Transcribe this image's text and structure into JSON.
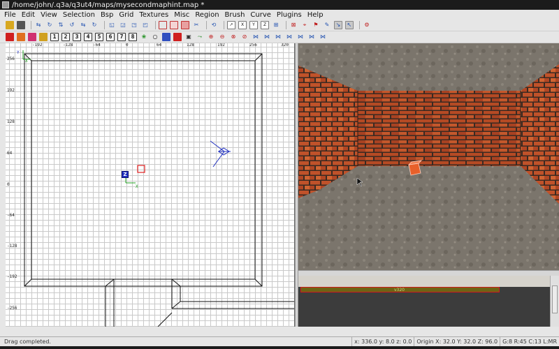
{
  "window": {
    "title": "/home/john/.q3a/q3ut4/maps/mysecondmaphint.map *"
  },
  "menu": [
    {
      "label": "File"
    },
    {
      "label": "Edit"
    },
    {
      "label": "View"
    },
    {
      "label": "Selection"
    },
    {
      "label": "Bsp"
    },
    {
      "label": "Grid"
    },
    {
      "label": "Textures"
    },
    {
      "label": "Misc"
    },
    {
      "label": "Region"
    },
    {
      "label": "Brush"
    },
    {
      "label": "Curve"
    },
    {
      "label": "Plugins"
    },
    {
      "label": "Help"
    }
  ],
  "toolbar2": {
    "numbers": [
      "1",
      "2",
      "3",
      "4",
      "5",
      "6",
      "7",
      "8"
    ]
  },
  "grid_view": {
    "x_ticks": [
      "-192",
      "-128",
      "-64",
      "0",
      "64",
      "128",
      "192",
      "256",
      "320"
    ],
    "y_ticks": [
      "256",
      "192",
      "128",
      "64",
      "0",
      "-64",
      "-128",
      "-192",
      "-256"
    ],
    "axis_y_label": "Y",
    "axis_x_label": "X",
    "origin_axis_label": "X",
    "z_label": "Z"
  },
  "texture_browser": {
    "tile_label": "v320"
  },
  "status": {
    "message": "Drag completed.",
    "coords": "x: 336.0  y: 8.0  z: 0.0",
    "origin": "Origin X: 32.0  Y: 32.0  Z: 96.0",
    "grid": "G:8 R:45 C:13 L:MR"
  },
  "colors": {
    "accent_selection": "#e02020",
    "camera_icon": "#2030c0",
    "brick": "#b04a26",
    "floor": "#7a746c"
  }
}
